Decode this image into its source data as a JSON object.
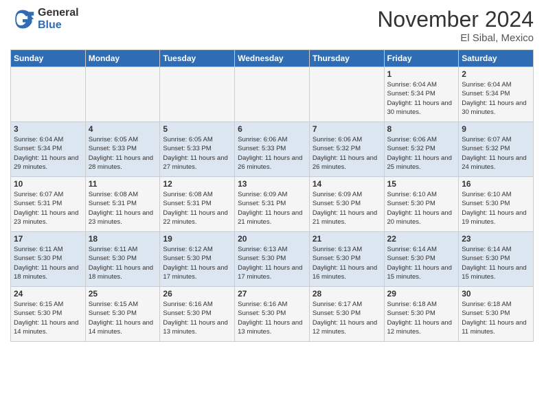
{
  "header": {
    "logo_general": "General",
    "logo_blue": "Blue",
    "month_title": "November 2024",
    "location": "El Sibal, Mexico"
  },
  "weekdays": [
    "Sunday",
    "Monday",
    "Tuesday",
    "Wednesday",
    "Thursday",
    "Friday",
    "Saturday"
  ],
  "weeks": [
    [
      {
        "day": "",
        "info": ""
      },
      {
        "day": "",
        "info": ""
      },
      {
        "day": "",
        "info": ""
      },
      {
        "day": "",
        "info": ""
      },
      {
        "day": "",
        "info": ""
      },
      {
        "day": "1",
        "info": "Sunrise: 6:04 AM\nSunset: 5:34 PM\nDaylight: 11 hours and 30 minutes."
      },
      {
        "day": "2",
        "info": "Sunrise: 6:04 AM\nSunset: 5:34 PM\nDaylight: 11 hours and 30 minutes."
      }
    ],
    [
      {
        "day": "3",
        "info": "Sunrise: 6:04 AM\nSunset: 5:34 PM\nDaylight: 11 hours and 29 minutes."
      },
      {
        "day": "4",
        "info": "Sunrise: 6:05 AM\nSunset: 5:33 PM\nDaylight: 11 hours and 28 minutes."
      },
      {
        "day": "5",
        "info": "Sunrise: 6:05 AM\nSunset: 5:33 PM\nDaylight: 11 hours and 27 minutes."
      },
      {
        "day": "6",
        "info": "Sunrise: 6:06 AM\nSunset: 5:33 PM\nDaylight: 11 hours and 26 minutes."
      },
      {
        "day": "7",
        "info": "Sunrise: 6:06 AM\nSunset: 5:32 PM\nDaylight: 11 hours and 26 minutes."
      },
      {
        "day": "8",
        "info": "Sunrise: 6:06 AM\nSunset: 5:32 PM\nDaylight: 11 hours and 25 minutes."
      },
      {
        "day": "9",
        "info": "Sunrise: 6:07 AM\nSunset: 5:32 PM\nDaylight: 11 hours and 24 minutes."
      }
    ],
    [
      {
        "day": "10",
        "info": "Sunrise: 6:07 AM\nSunset: 5:31 PM\nDaylight: 11 hours and 23 minutes."
      },
      {
        "day": "11",
        "info": "Sunrise: 6:08 AM\nSunset: 5:31 PM\nDaylight: 11 hours and 23 minutes."
      },
      {
        "day": "12",
        "info": "Sunrise: 6:08 AM\nSunset: 5:31 PM\nDaylight: 11 hours and 22 minutes."
      },
      {
        "day": "13",
        "info": "Sunrise: 6:09 AM\nSunset: 5:31 PM\nDaylight: 11 hours and 21 minutes."
      },
      {
        "day": "14",
        "info": "Sunrise: 6:09 AM\nSunset: 5:30 PM\nDaylight: 11 hours and 21 minutes."
      },
      {
        "day": "15",
        "info": "Sunrise: 6:10 AM\nSunset: 5:30 PM\nDaylight: 11 hours and 20 minutes."
      },
      {
        "day": "16",
        "info": "Sunrise: 6:10 AM\nSunset: 5:30 PM\nDaylight: 11 hours and 19 minutes."
      }
    ],
    [
      {
        "day": "17",
        "info": "Sunrise: 6:11 AM\nSunset: 5:30 PM\nDaylight: 11 hours and 18 minutes."
      },
      {
        "day": "18",
        "info": "Sunrise: 6:11 AM\nSunset: 5:30 PM\nDaylight: 11 hours and 18 minutes."
      },
      {
        "day": "19",
        "info": "Sunrise: 6:12 AM\nSunset: 5:30 PM\nDaylight: 11 hours and 17 minutes."
      },
      {
        "day": "20",
        "info": "Sunrise: 6:13 AM\nSunset: 5:30 PM\nDaylight: 11 hours and 17 minutes."
      },
      {
        "day": "21",
        "info": "Sunrise: 6:13 AM\nSunset: 5:30 PM\nDaylight: 11 hours and 16 minutes."
      },
      {
        "day": "22",
        "info": "Sunrise: 6:14 AM\nSunset: 5:30 PM\nDaylight: 11 hours and 15 minutes."
      },
      {
        "day": "23",
        "info": "Sunrise: 6:14 AM\nSunset: 5:30 PM\nDaylight: 11 hours and 15 minutes."
      }
    ],
    [
      {
        "day": "24",
        "info": "Sunrise: 6:15 AM\nSunset: 5:30 PM\nDaylight: 11 hours and 14 minutes."
      },
      {
        "day": "25",
        "info": "Sunrise: 6:15 AM\nSunset: 5:30 PM\nDaylight: 11 hours and 14 minutes."
      },
      {
        "day": "26",
        "info": "Sunrise: 6:16 AM\nSunset: 5:30 PM\nDaylight: 11 hours and 13 minutes."
      },
      {
        "day": "27",
        "info": "Sunrise: 6:16 AM\nSunset: 5:30 PM\nDaylight: 11 hours and 13 minutes."
      },
      {
        "day": "28",
        "info": "Sunrise: 6:17 AM\nSunset: 5:30 PM\nDaylight: 11 hours and 12 minutes."
      },
      {
        "day": "29",
        "info": "Sunrise: 6:18 AM\nSunset: 5:30 PM\nDaylight: 11 hours and 12 minutes."
      },
      {
        "day": "30",
        "info": "Sunrise: 6:18 AM\nSunset: 5:30 PM\nDaylight: 11 hours and 11 minutes."
      }
    ]
  ]
}
